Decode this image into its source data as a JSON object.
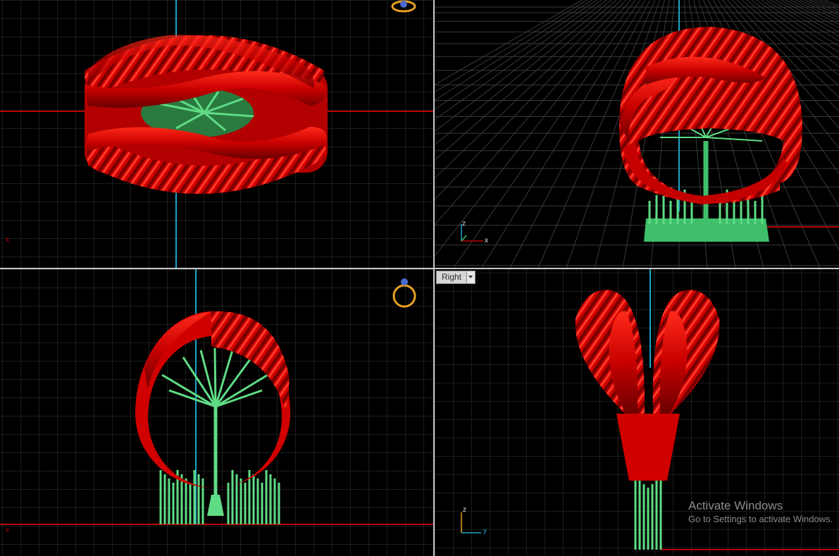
{
  "viewports": {
    "top": {
      "axis_h": "x"
    },
    "perspective": {
      "axis_h": "x",
      "axis_v": "z"
    },
    "front": {
      "axis_h": "x"
    },
    "right": {
      "tab_label": "Right",
      "axis_h": "y",
      "axis_v": "z"
    }
  },
  "watermark": {
    "line1": "Activate Windows",
    "line2": "Go to Settings to activate Windows."
  },
  "colors": {
    "background": "#000000",
    "grid": "#3a3a3a",
    "axis_red": "#b40000",
    "axis_cyan": "#1aa5c8",
    "model_red": "#e00000",
    "support_green": "#3fbf6a"
  },
  "icons": [
    "ring-gizmo-icon",
    "dropdown-icon"
  ]
}
